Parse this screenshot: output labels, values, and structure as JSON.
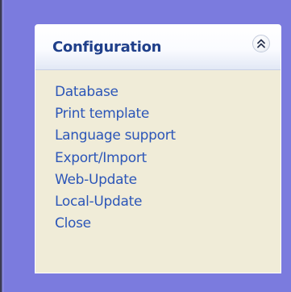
{
  "panel": {
    "title": "Configuration",
    "collapse_icon": "chevron-double-up-icon",
    "items": [
      {
        "label": "Database"
      },
      {
        "label": "Print template"
      },
      {
        "label": "Language support"
      },
      {
        "label": "Export/Import"
      },
      {
        "label": "Web-Update"
      },
      {
        "label": "Local-Update"
      },
      {
        "label": "Close"
      }
    ]
  },
  "colors": {
    "background": "#7b7bde",
    "panel_body": "#f0ecd8",
    "title_text": "#1f3f8a",
    "link_text": "#2c56b8"
  }
}
